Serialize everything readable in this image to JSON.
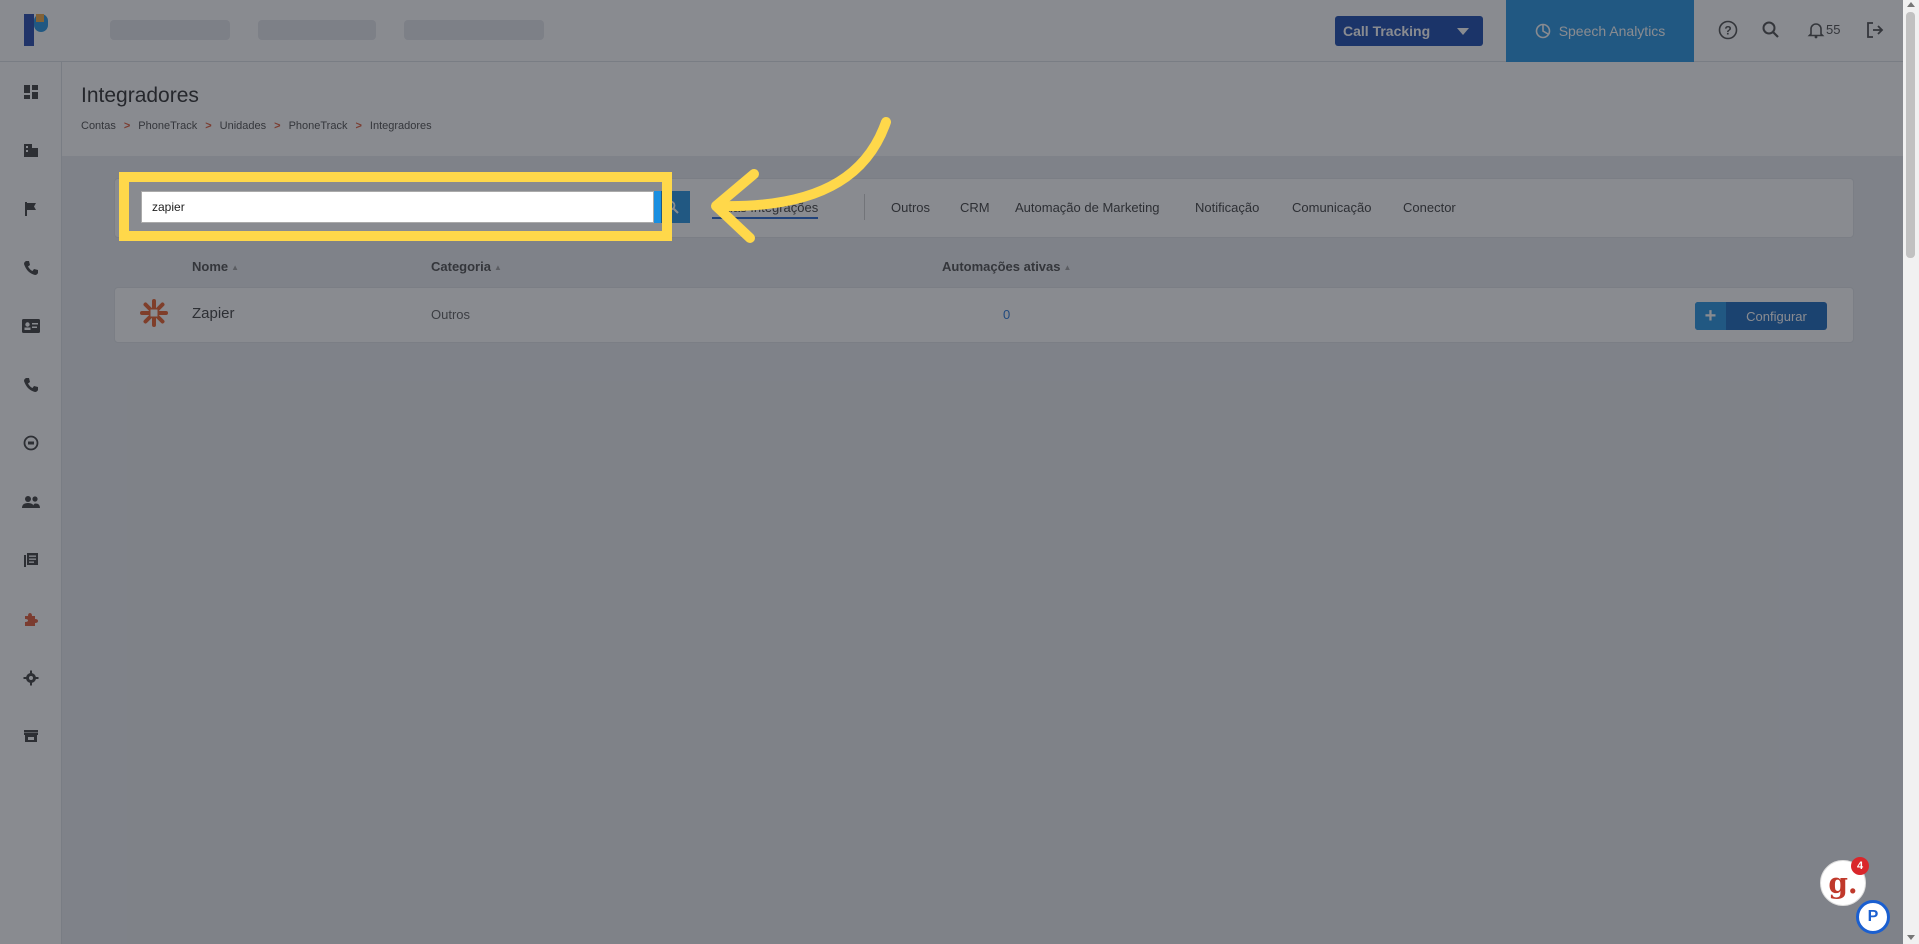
{
  "topbar": {
    "product_select": "Call Tracking",
    "speech_analytics": "Speech Analytics",
    "notifications_count": "55"
  },
  "page": {
    "title": "Integradores",
    "breadcrumb": [
      "Contas",
      "PhoneTrack",
      "Unidades",
      "PhoneTrack",
      "Integradores"
    ],
    "breadcrumb_sep": ">"
  },
  "filters": {
    "search_value": "zapier",
    "tabs": [
      "Todas Integrações",
      "Outros",
      "CRM",
      "Automação de Marketing",
      "Notificação",
      "Comunicação",
      "Conector"
    ],
    "active_tab_visible_text": "gracões",
    "active_tab_visible_prefix": "T"
  },
  "table": {
    "headers": [
      "Nome",
      "Categoria",
      "Automações ativas"
    ],
    "rows": [
      {
        "name": "Zapier",
        "category": "Outros",
        "active_automations": "0",
        "action": "Configurar"
      }
    ]
  },
  "chat": {
    "badge": "4",
    "g_label": "g."
  },
  "colors": {
    "brand_blue": "#0d3fa8",
    "accent_blue": "#1a8fe0",
    "breadcrumb_sep": "#e0502a",
    "highlight": "#ffd84a",
    "zapier_orange": "#e8551e"
  }
}
